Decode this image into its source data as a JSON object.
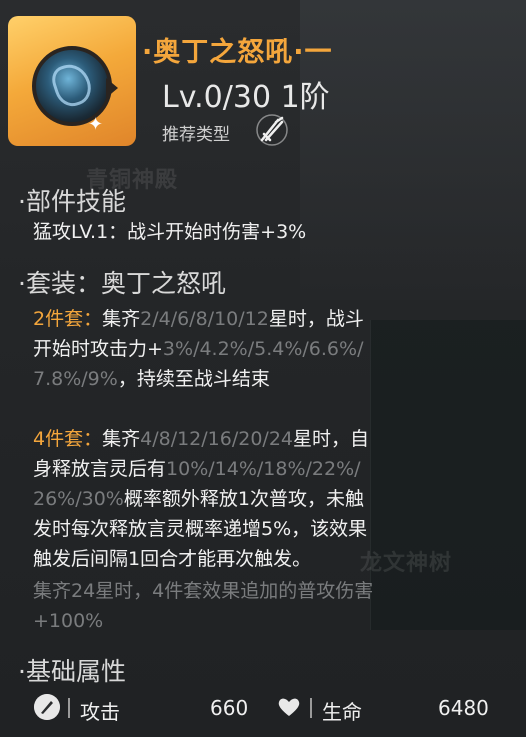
{
  "header": {
    "title": "·奥丁之怒吼·一",
    "level": "Lv.0/30  1阶",
    "recommend_label": "推荐类型",
    "recommend_icon": "crossed-swords-icon"
  },
  "watermarks": {
    "top": "青铜神殿",
    "right": "龙文神树"
  },
  "skill": {
    "heading": "部件技能",
    "line": "猛攻LV.1：战斗开始时伤害+3%"
  },
  "set": {
    "heading": "套装：奥丁之怒吼",
    "two_label": "2件套：",
    "two_l1a": "集齐",
    "two_l1b": "2/4/6/8/10/12",
    "two_l1c": "星时，战斗",
    "two_l2a": "开始时攻击力+",
    "two_l2b": "3%/4.2%/5.4%/6.6%/",
    "two_l3a": "7.8%/9%",
    "two_l3b": "，持续至战斗结束",
    "four_label": "4件套：",
    "four_l1a": "集齐",
    "four_l1b": "4/8/12/16/20/24",
    "four_l1c": "星时，自",
    "four_l2a": "身释放言灵后有",
    "four_l2b": "10%/14%/18%/22%/",
    "four_l3a": "26%/30%",
    "four_l3b": "概率额外释放1次普攻，未触",
    "four_l4": "发时每次释放言灵概率递增5%，该效果",
    "four_l5": "触发后间隔1回合才能再次触发。",
    "bonus_l1": "集齐24星时，4件套效果追加的普攻伤害",
    "bonus_l2": "+100%"
  },
  "base": {
    "heading": "基础属性",
    "attack_label": "攻击",
    "attack_value": "660",
    "attack_icon": "quill-icon",
    "hp_label": "生命",
    "hp_value": "6480",
    "hp_icon": "heart-icon"
  },
  "colors": {
    "accent": "#f4a63c",
    "dim": "#7a7c7e"
  }
}
